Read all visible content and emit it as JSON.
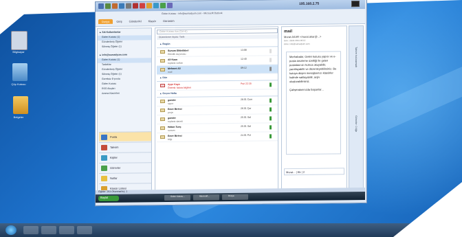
{
  "window": {
    "ip_label": "195.168.2.75",
    "title": "Gelen Kutusu - info@sumadyum.com - Microsoft Outlook"
  },
  "ribbon_tabs": [
    "Dosya",
    "Giriş",
    "Gönder/Al",
    "Klasör",
    "Görünüm"
  ],
  "navigation": {
    "groups": [
      {
        "header": "▲ Sık Kullanılanlar",
        "items": [
          "Gelen Kutusu (1)",
          "Gönderilmiş Öğeler",
          "Silinmiş Öğeler (1)"
        ]
      },
      {
        "header": "▲ info@sumadyum.com",
        "items": [
          "Gelen Kutusu (1)",
          "Taslaklar",
          "Gönderilmiş Öğeler",
          "Silinmiş Öğeler (1)",
          "Gereksiz E-posta",
          "Giden Kutusu",
          "RSS Akışları",
          "Arama Klasörleri"
        ]
      }
    ],
    "buttons": [
      {
        "label": "Posta",
        "color": "#3a76c4"
      },
      {
        "label": "Takvim",
        "color": "#c44c3a"
      },
      {
        "label": "Kişiler",
        "color": "#3a9ac4"
      },
      {
        "label": "Görevler",
        "color": "#4aa04a"
      },
      {
        "label": "Notlar",
        "color": "#e8c040"
      },
      {
        "label": "Klasör Listesi",
        "color": "#d8a030"
      }
    ]
  },
  "message_list": {
    "search_placeholder": "Gelen Kutusu Ara (Ctrl+E)",
    "column_header": "Düzenleme ölçütü: Tarih",
    "groups": [
      {
        "label": "▲ Bugün",
        "rows": [
          {
            "from": "Sunum Etkinlikleri",
            "subject": "Etkinlik duyurusu",
            "time": "13:08",
            "style": "normal"
          },
          {
            "from": "Ali Kaan",
            "subject": "toplantı notları",
            "time": "12:40",
            "style": "normal"
          },
          {
            "from": "Mehmet Ali",
            "subject": "mail",
            "time": "09:12",
            "style": "selected"
          }
        ]
      },
      {
        "label": "▲ Dün",
        "rows": [
          {
            "from": "Ayşe Kaya",
            "subject": "Önemli: fatura bilgileri",
            "time": "Paz 22:35",
            "style": "red"
          }
        ]
      },
      {
        "label": "▲ Geçen Hafta",
        "rows": [
          {
            "from": "gonder",
            "subject": "rapor",
            "time": "28.01 Cum",
            "style": "normal"
          },
          {
            "from": "Emre Birinci",
            "subject": "proje",
            "time": "26.01 Çar",
            "style": "normal"
          },
          {
            "from": "gonder",
            "subject": "toplantı daveti",
            "time": "25.01 Sal",
            "style": "normal"
          },
          {
            "from": "Hakan Tunç",
            "subject": "sunum",
            "time": "25.01 Sal",
            "style": "normal"
          },
          {
            "from": "Emre Birinci",
            "subject": "bilgi",
            "time": "24.01 Pzt",
            "style": "normal"
          }
        ]
      }
    ]
  },
  "reading_pane": {
    "title": "mail",
    "from": "Murat AKAR <murat.akar@...>",
    "meta": [
      "Gön.: 28.01.2011 09:12",
      "Kime: info@sumadyum.com"
    ],
    "body": "Merhabalar, Gelen kutusu yapısı ve e-posta önizleme özelliği ile gelen postalarınızı hızlıca okuyabilir, yanıtlayabilir ve düzenleyebilirsiniz. Bu kutuya düşen mesajlarınızı klasörler halinde saklayabilir, arşiv oluşturabilirsiniz.",
    "signature": "Çalışmalarınızda başarılar...",
    "footer": "Murat... | Ek | 2"
  },
  "todo_bar": {
    "label_top": "Takvim bulunamadı",
    "label_bottom": "Görevler: 0 öğe"
  },
  "status_bar": {
    "text": "Öğeler: 253   Okunmamış: 1"
  },
  "taskbar": {
    "start_label": "Başlat",
    "items": [
      "Gelen Kutusu...",
      "Microsoft...",
      "Dosya"
    ]
  },
  "desktop_icons": [
    {
      "label": "Bilgisayar",
      "color": "#cfd8e6"
    },
    {
      "label": "Çöp Kutusu",
      "color": "#7fb0e0"
    },
    {
      "label": "Belgeler",
      "color": "#e8b040"
    }
  ],
  "colors": {
    "accent": "#f0a030",
    "desktop": "#1c6fc8",
    "selection": "#cde2f7"
  }
}
